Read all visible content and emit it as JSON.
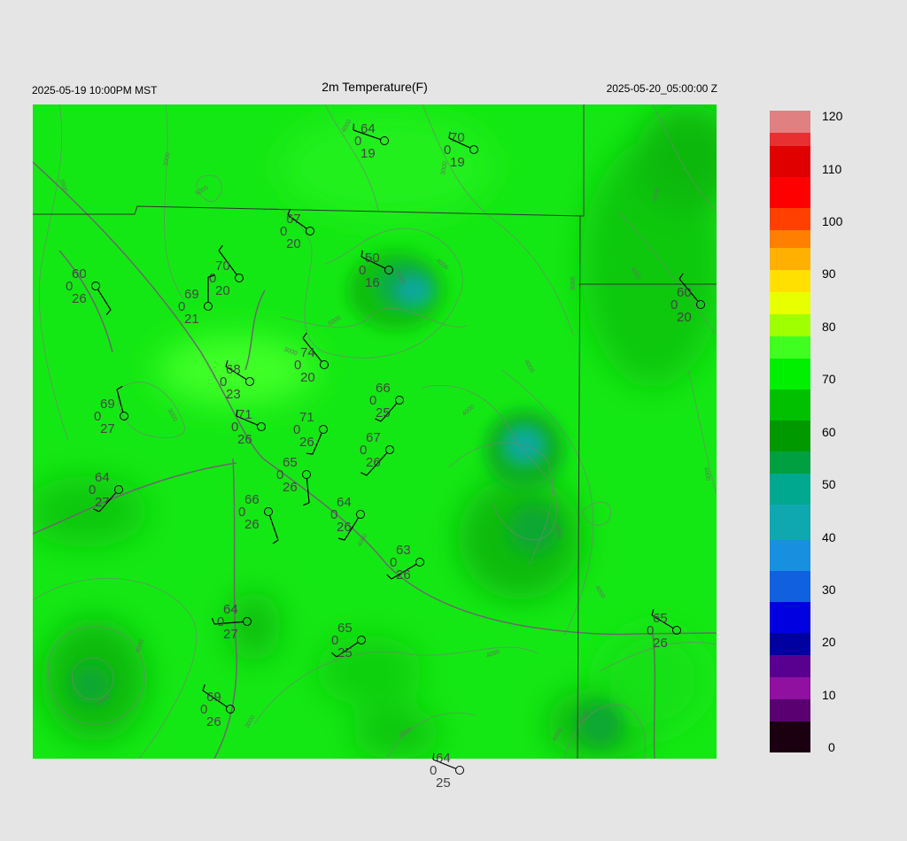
{
  "header": {
    "left": "2025-05-19 10:00PM MST",
    "title": "2m Temperature(F)",
    "right": "2025-05-20_05:00:00 Z"
  },
  "colorbar": {
    "ticks": [
      "120",
      "110",
      "100",
      "90",
      "80",
      "70",
      "60",
      "50",
      "40",
      "30",
      "20",
      "10",
      "0"
    ],
    "min": 0,
    "max": 120,
    "stops": [
      [
        0,
        "#1a0010"
      ],
      [
        6,
        "#5a0070"
      ],
      [
        10,
        "#9010a0"
      ],
      [
        14,
        "#5a0090"
      ],
      [
        18,
        "#0000a0"
      ],
      [
        22,
        "#0000e0"
      ],
      [
        28,
        "#1060e0"
      ],
      [
        34,
        "#1890e0"
      ],
      [
        40,
        "#10a8b0"
      ],
      [
        46,
        "#00a890"
      ],
      [
        52,
        "#00a040"
      ],
      [
        56,
        "#009a00"
      ],
      [
        62,
        "#00c000"
      ],
      [
        68,
        "#00f000"
      ],
      [
        74,
        "#40ff20"
      ],
      [
        78,
        "#a0ff00"
      ],
      [
        82,
        "#e8ff00"
      ],
      [
        86,
        "#ffe000"
      ],
      [
        90,
        "#ffb000"
      ],
      [
        94,
        "#ff8000"
      ],
      [
        98,
        "#ff4000"
      ],
      [
        102,
        "#ff0000"
      ],
      [
        108,
        "#e00000"
      ],
      [
        113,
        "#e83030"
      ],
      [
        116,
        "#e08080"
      ],
      [
        120,
        "#d8c8c8"
      ]
    ]
  },
  "stations": [
    {
      "t": "64",
      "d": "19",
      "p": "0"
    },
    {
      "t": "70",
      "d": "19",
      "p": "0"
    },
    {
      "t": "67",
      "d": "20",
      "p": "0"
    },
    {
      "t": "50",
      "d": "16",
      "p": "0"
    },
    {
      "t": "60",
      "d": "26",
      "p": "0"
    },
    {
      "t": "70",
      "d": "20",
      "p": "0"
    },
    {
      "t": "69",
      "d": "21",
      "p": "0"
    },
    {
      "t": "60",
      "d": "20",
      "p": "0"
    },
    {
      "t": "74",
      "d": "20",
      "p": "0"
    },
    {
      "t": "68",
      "d": "23",
      "p": "0"
    },
    {
      "t": "69",
      "d": "27",
      "p": "0"
    },
    {
      "t": "66",
      "d": "25",
      "p": "0"
    },
    {
      "t": "71",
      "d": "26",
      "p": "0"
    },
    {
      "t": "71",
      "d": "26",
      "p": "0"
    },
    {
      "t": "67",
      "d": "26",
      "p": "0"
    },
    {
      "t": "64",
      "d": "27",
      "p": "0"
    },
    {
      "t": "65",
      "d": "26",
      "p": "0"
    },
    {
      "t": "66",
      "d": "26",
      "p": "0"
    },
    {
      "t": "64",
      "d": "26",
      "p": "0"
    },
    {
      "t": "63",
      "d": "26",
      "p": "0"
    },
    {
      "t": "64",
      "d": "27",
      "p": "0"
    },
    {
      "t": "65",
      "d": "25",
      "p": "0"
    },
    {
      "t": "65",
      "d": "26",
      "p": "0"
    },
    {
      "t": "69",
      "d": "26",
      "p": "0"
    },
    {
      "t": "64",
      "d": "25",
      "p": "0"
    }
  ],
  "contour_labels": [
    "2000",
    "3000",
    "4000",
    "5000"
  ]
}
